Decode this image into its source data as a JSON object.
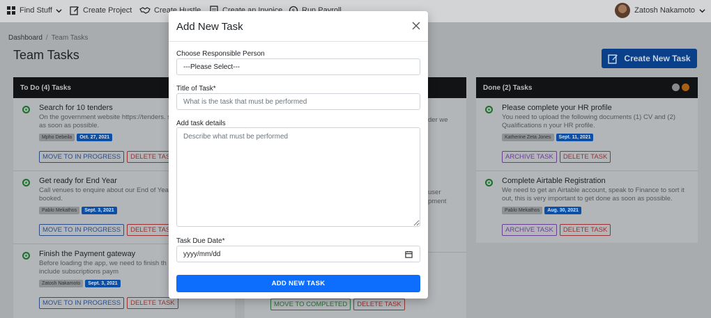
{
  "nav": {
    "find_stuff": "Find Stuff",
    "create_project": "Create Project",
    "create_hustle": "Create Hustle",
    "create_invoice": "Create an Invoice",
    "run_payroll": "Run Payroll",
    "user_name": "Zatosh Nakamoto"
  },
  "page": {
    "breadcrumb_home": "Dashboard",
    "breadcrumb_sep": "/",
    "breadcrumb_current": "Team Tasks",
    "title": "Team Tasks",
    "create_button": "Create New Task"
  },
  "columns": {
    "todo": {
      "header": "To Do (4) Tasks",
      "tasks": [
        {
          "title": "Search for 10 tenders",
          "desc": "On the government website https://tenders. submit more tenders as soon as possible.",
          "person": "Mpho Debeila",
          "date": "Oct. 27, 2021",
          "primary": "MOVE TO IN PROGRESS",
          "secondary": "DELETE TASK"
        },
        {
          "title": "Get ready for End Year",
          "desc": "Call venues to enquire about our End of Yea they all get fully booked.",
          "person": "Pablo Mekathos",
          "date": "Sept. 3, 2021",
          "primary": "MOVE TO IN PROGRESS",
          "secondary": "DELETE TASK"
        },
        {
          "title": "Finish the Payment gateway",
          "desc": "Before loading the app, we need to finish th processing and include subscriptions paym",
          "person": "Zatosh Nakamoto",
          "date": "Sept. 3, 2021",
          "primary": "MOVE TO IN PROGRESS",
          "secondary": "DELETE TASK"
        }
      ]
    },
    "middle": {
      "fragments": [
        "der we",
        "user",
        "pment"
      ],
      "primary": "MOVE TO COMPLETED",
      "secondary": "DELETE TASK"
    },
    "done": {
      "header": "Done (2) Tasks",
      "tasks": [
        {
          "title": "Please complete your HR profile",
          "desc": "You need to upload the following documents (1) CV and (2) Qualifications n your HR profile.",
          "person": "Katherine Zeta Jones",
          "date": "Sept. 11, 2021",
          "primary": "ARCHIVE TASK",
          "secondary": "DELETE TASK"
        },
        {
          "title": "Complete Airtable Registration",
          "desc": "We need to get an Airtable account, speak to Finance to sort it out, this is very important to get done as soon as possible.",
          "person": "Pablo Mekathos",
          "date": "Aug. 30, 2021",
          "primary": "ARCHIVE TASK",
          "secondary": "DELETE TASK"
        }
      ]
    }
  },
  "modal": {
    "title": "Add New Task",
    "person_label": "Choose Responsible Person",
    "person_selected": "---Please Select---",
    "title_label": "Title of Task*",
    "title_placeholder": "What is the task that must be performed",
    "details_label": "Add task details",
    "details_placeholder": "Describe what must be performed",
    "due_label": "Task Due Date*",
    "due_placeholder": "yyyy/mm/dd",
    "submit": "ADD NEW TASK"
  }
}
